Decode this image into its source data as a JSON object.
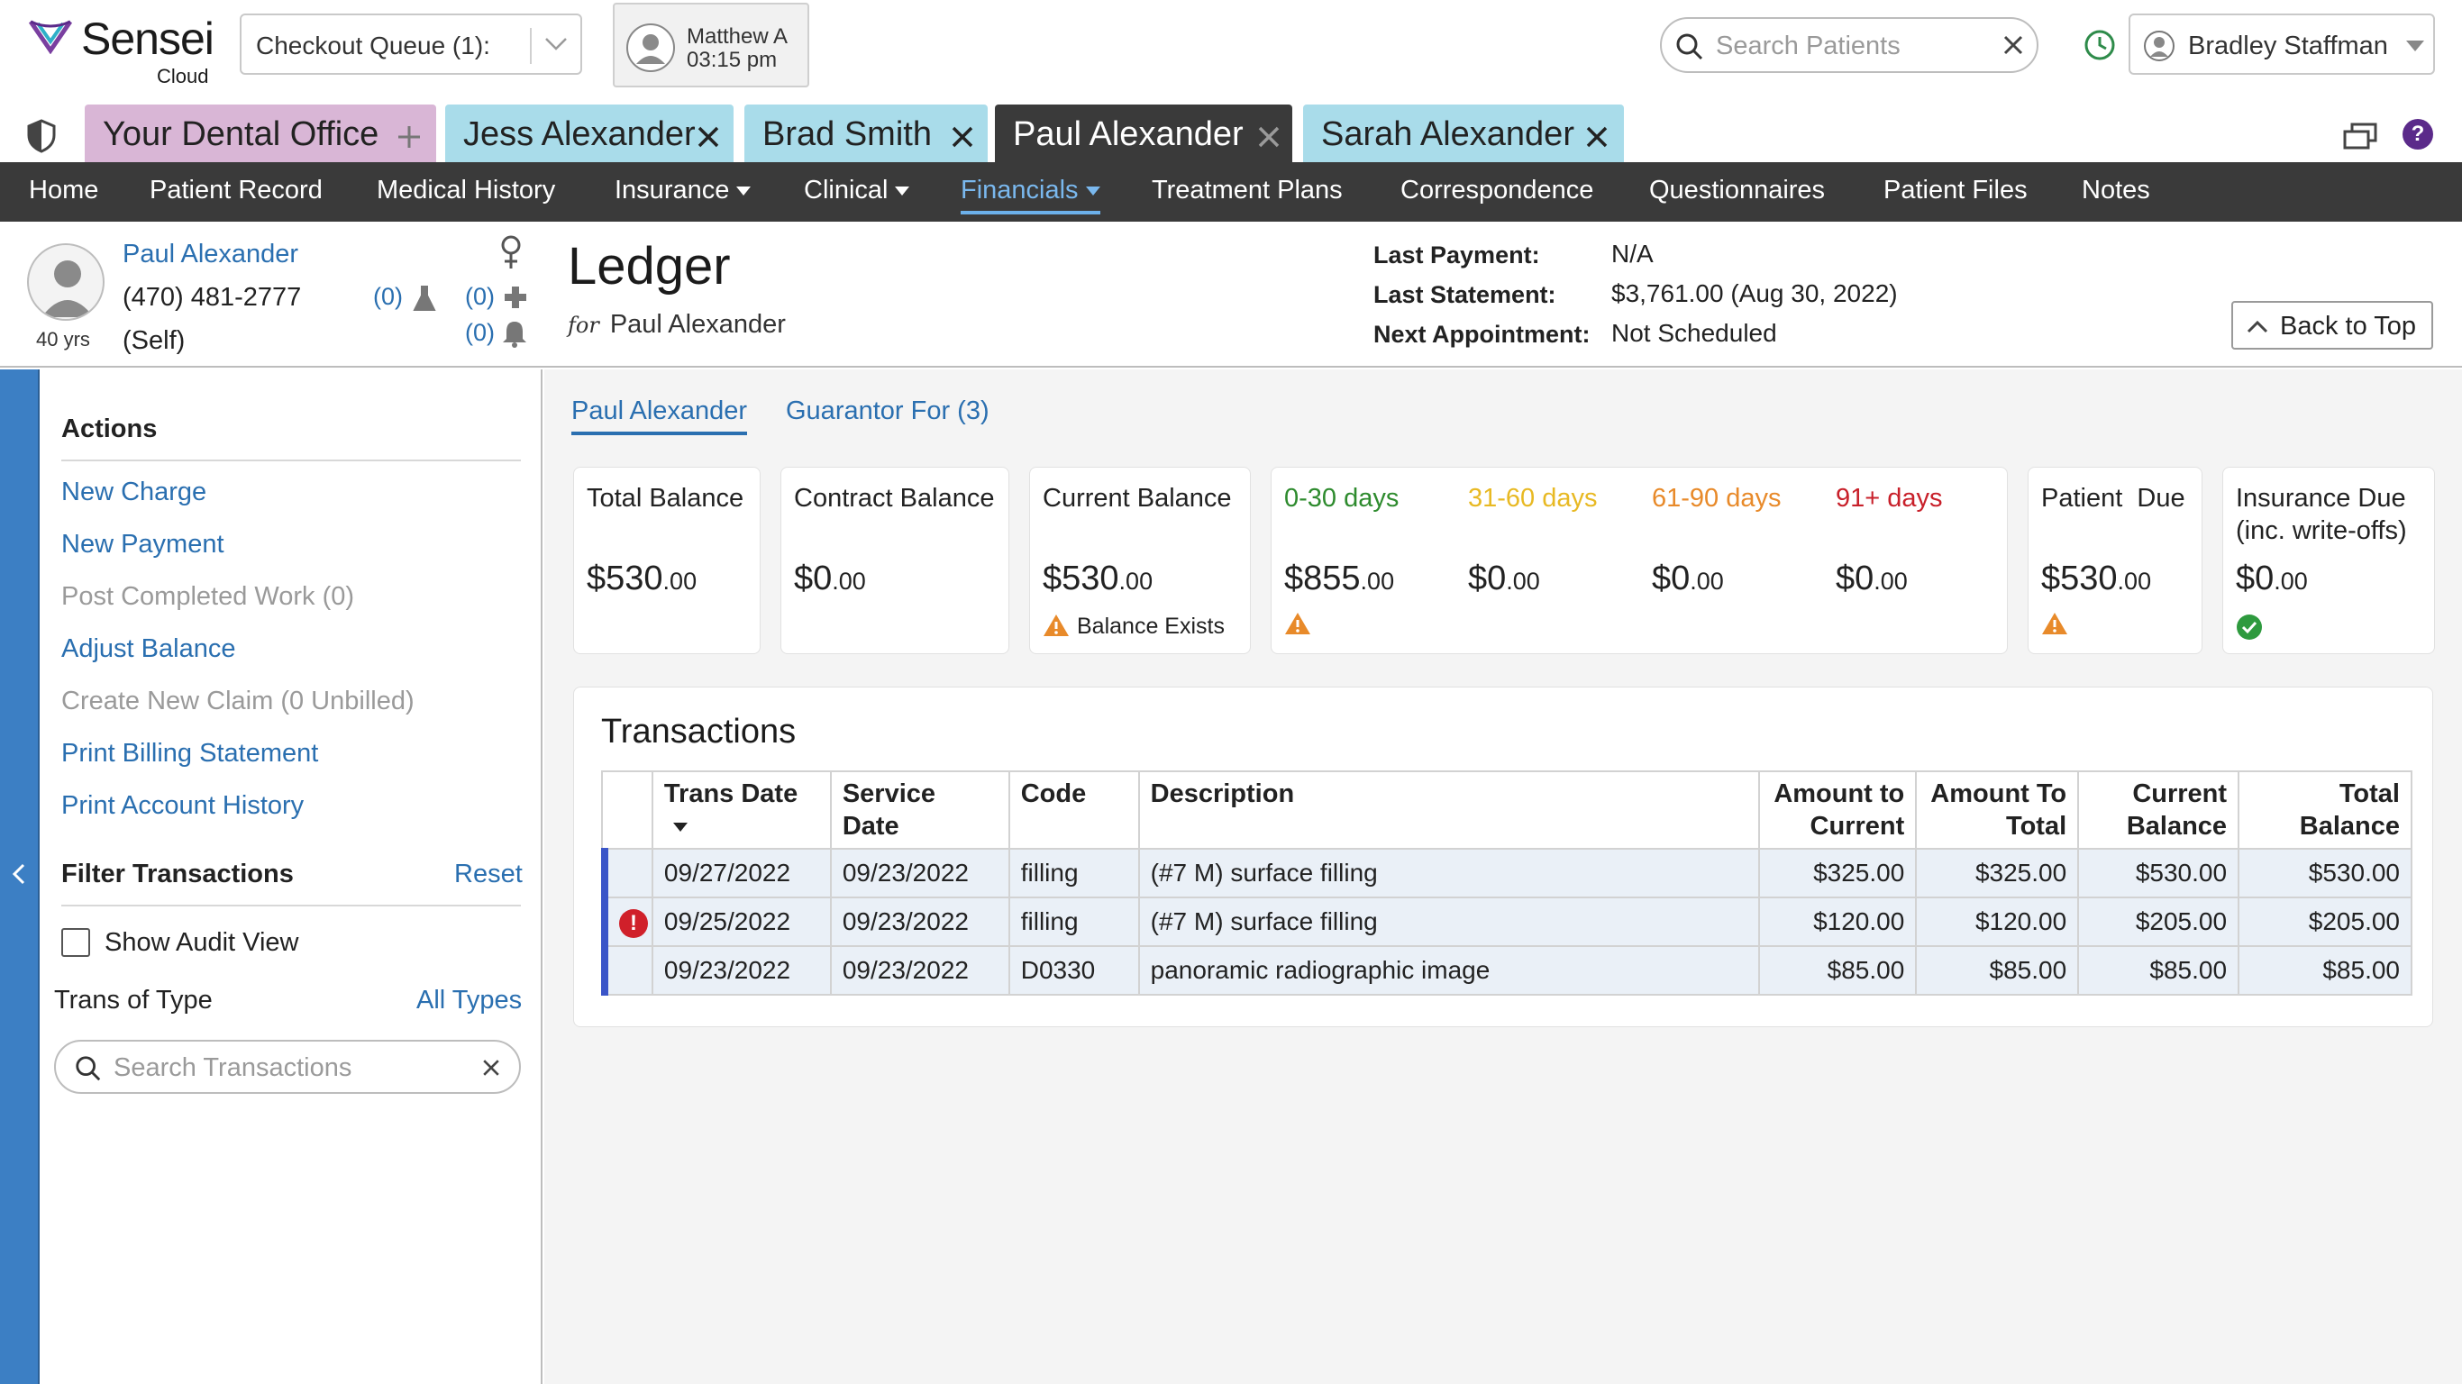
{
  "app": {
    "logo_text": "Sensei",
    "logo_sub": "Cloud",
    "checkout_queue": "Checkout Queue (1):",
    "provider_name": "Matthew A",
    "provider_time": "03:15 pm",
    "search_placeholder": "Search Patients",
    "user_name": "Bradley Staffman"
  },
  "tabs": [
    {
      "label": "Your Dental Office",
      "icon": "plus-icon",
      "color": "#d9b6d6"
    },
    {
      "label": "Jess Alexander",
      "icon": "close-icon",
      "color": "#a9dcea"
    },
    {
      "label": "Brad Smith",
      "icon": "close-icon",
      "color": "#a9dcea"
    },
    {
      "label": "Paul Alexander",
      "icon": "close-icon",
      "color": "#3a3a3a"
    },
    {
      "label": "Sarah Alexander",
      "icon": "close-icon",
      "color": "#a9dcea"
    }
  ],
  "nav": [
    {
      "label": "Home"
    },
    {
      "label": "Patient Record"
    },
    {
      "label": "Medical History"
    },
    {
      "label": "Insurance"
    },
    {
      "label": "Clinical"
    },
    {
      "label": "Financials"
    },
    {
      "label": "Treatment Plans"
    },
    {
      "label": "Correspondence"
    },
    {
      "label": "Questionnaires"
    },
    {
      "label": "Patient Files"
    },
    {
      "label": "Notes"
    }
  ],
  "patient": {
    "name": "Paul Alexander",
    "phone": "(470) 481-2777",
    "relation": "(Self)",
    "age": "40 yrs",
    "count_lab": "(0)",
    "count_med": "(0)",
    "count_alert": "(0)",
    "count_extra": "(0)"
  },
  "ledger": {
    "title": "Ledger",
    "for_label": "for",
    "for_name": "Paul Alexander",
    "last_payment_label": "Last Payment:",
    "last_payment_value": "N/A",
    "last_statement_label": "Last Statement:",
    "last_statement_value": "$3,761.00 (Aug 30, 2022)",
    "next_appt_label": "Next Appointment:",
    "next_appt_value": "Not Scheduled",
    "back_to_top": "Back to Top"
  },
  "sidebar": {
    "actions_title": "Actions",
    "actions": [
      {
        "label": "New Charge",
        "enabled": true
      },
      {
        "label": "New Payment",
        "enabled": true
      },
      {
        "label": "Post Completed Work (0)",
        "enabled": false
      },
      {
        "label": "Adjust Balance",
        "enabled": true
      },
      {
        "label": "Create New Claim (0 Unbilled)",
        "enabled": false
      },
      {
        "label": "Print Billing Statement",
        "enabled": true
      },
      {
        "label": "Print Account History",
        "enabled": true
      }
    ],
    "filter_title": "Filter Transactions",
    "reset": "Reset",
    "show_audit": "Show Audit View",
    "trans_of_type": "Trans of Type",
    "all_types": "All Types",
    "search_placeholder": "Search Transactions"
  },
  "subtabs": [
    {
      "label": "Paul Alexander"
    },
    {
      "label": "Guarantor For (3)"
    }
  ],
  "balances": {
    "total": {
      "label": "Total Balance",
      "dollars": "$530",
      "cents": ".00"
    },
    "contract": {
      "label": "Contract Balance",
      "dollars": "$0",
      "cents": ".00"
    },
    "current": {
      "label": "Current Balance",
      "dollars": "$530",
      "cents": ".00",
      "note": "Balance Exists"
    },
    "aging": [
      {
        "label": "0-30 days",
        "dollars": "$855",
        "cents": ".00",
        "color": "#2e8b2e"
      },
      {
        "label": "31-60 days",
        "dollars": "$0",
        "cents": ".00",
        "color": "#e8b923"
      },
      {
        "label": "61-90 days",
        "dollars": "$0",
        "cents": ".00",
        "color": "#e88a2a"
      },
      {
        "label": "91+ days",
        "dollars": "$0",
        "cents": ".00",
        "color": "#c8202a"
      }
    ],
    "patient_due": {
      "label": "Patient  Due",
      "dollars": "$530",
      "cents": ".00"
    },
    "insurance_due": {
      "label1": "Insurance Due",
      "label2": "(inc. write-offs)",
      "dollars": "$0",
      "cents": ".00"
    }
  },
  "transactions": {
    "title": "Transactions",
    "headers": {
      "trans_date": "Trans Date",
      "service_date": "Service Date",
      "code": "Code",
      "description": "Description",
      "amt_current_1": "Amount to",
      "amt_current_2": "Current",
      "amt_total_1": "Amount To",
      "amt_total_2": "Total",
      "cur_bal_1": "Current",
      "cur_bal_2": "Balance",
      "tot_bal_1": "Total",
      "tot_bal_2": "Balance"
    },
    "rows": [
      {
        "trans_date": "09/27/2022",
        "service_date": "09/23/2022",
        "code": "filling",
        "description": "(#7 M) surface filling",
        "amt_current": "$325.00",
        "amt_total": "$325.00",
        "current_balance": "$530.00",
        "total_balance": "$530.00",
        "error": false
      },
      {
        "trans_date": "09/25/2022",
        "service_date": "09/23/2022",
        "code": "filling",
        "description": "(#7 M) surface filling",
        "amt_current": "$120.00",
        "amt_total": "$120.00",
        "current_balance": "$205.00",
        "total_balance": "$205.00",
        "error": true
      },
      {
        "trans_date": "09/23/2022",
        "service_date": "09/23/2022",
        "code": "D0330",
        "description": "panoramic radiographic image",
        "amt_current": "$85.00",
        "amt_total": "$85.00",
        "current_balance": "$85.00",
        "total_balance": "$85.00",
        "error": false
      }
    ]
  }
}
